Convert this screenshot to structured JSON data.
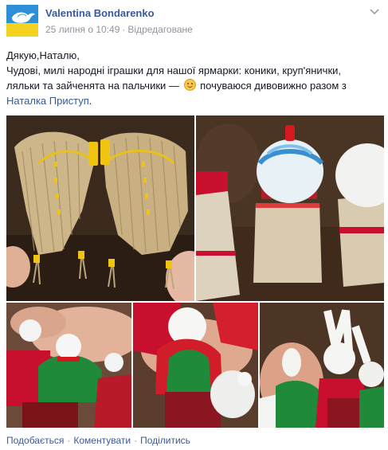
{
  "post": {
    "author": "Valentina Bondarenko",
    "date": "25 липня о 10:49",
    "separator": "·",
    "edited": "Відредаговане",
    "text_line1": "Дякую,Наталю,",
    "text_line2": "Чудові, милі народні іграшки для нашої ярмарки: коники, круп'янички,",
    "text_line3_pre": "ляльки та зайченята на пальчики — ",
    "text_line3_post": " почуваюся дивовижно разом з",
    "tagged_person": "Наталка Приступ",
    "tagged_suffix": "."
  },
  "icons": {
    "avatar": "dove-flag-avatar",
    "emoji": "smiley-icon",
    "options": "chevron-down-icon"
  },
  "actions": {
    "like": "Подобається",
    "comment": "Коментувати",
    "share": "Поділитись",
    "dot": "·"
  },
  "colors": {
    "link": "#3b5998",
    "meta": "#90949c",
    "text": "#141823"
  }
}
